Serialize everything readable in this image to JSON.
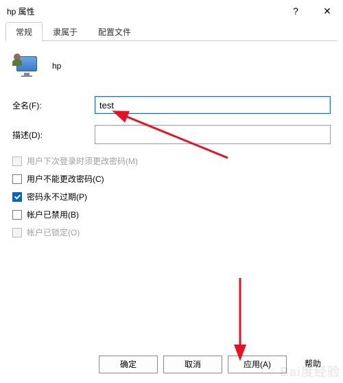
{
  "window": {
    "title": "hp 属性",
    "help_glyph": "?",
    "close_glyph": "✕"
  },
  "tabs": {
    "general": "常规",
    "member_of": "隶属于",
    "profile": "配置文件"
  },
  "user": {
    "name": "hp"
  },
  "fields": {
    "fullname_label": "全名(F):",
    "fullname_value": "test",
    "description_label": "描述(D):",
    "description_value": ""
  },
  "checks": {
    "must_change": "用户下次登录时须更改密码(M)",
    "cannot_change": "用户不能更改密码(C)",
    "never_expires": "密码永不过期(P)",
    "disabled": "帐户已禁用(B)",
    "locked": "帐户已锁定(O)"
  },
  "buttons": {
    "ok": "确定",
    "cancel": "取消",
    "apply": "应用(A)",
    "help": "帮助"
  },
  "watermark": {
    "main": "Bai度经验",
    "sub": ""
  }
}
